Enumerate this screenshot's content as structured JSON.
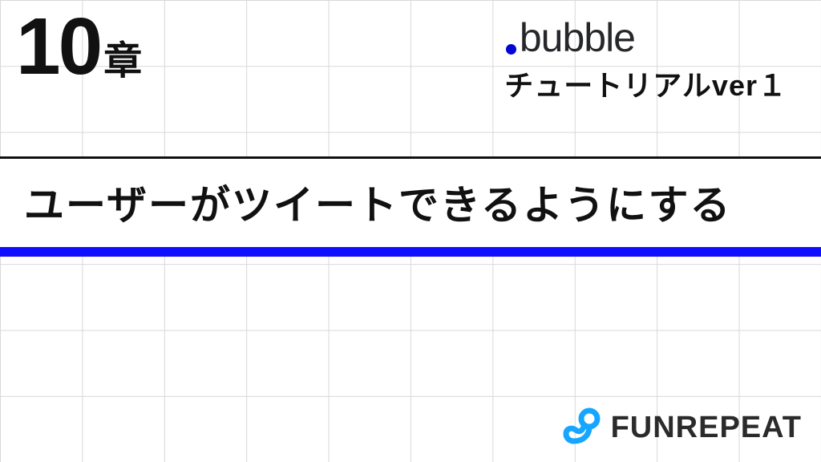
{
  "chapter": {
    "number": "10",
    "suffix": "章"
  },
  "brand": {
    "name": "bubble",
    "tutorial_label": "チュートリアルver１"
  },
  "title": "ユーザーがツイートできるようにする",
  "footer": {
    "company": "FUNREPEAT"
  },
  "colors": {
    "accent": "#0f0fff",
    "bubble_dot": "#0205d3",
    "text": "#111111",
    "funrepeat_icon": "#0aa8ff"
  }
}
